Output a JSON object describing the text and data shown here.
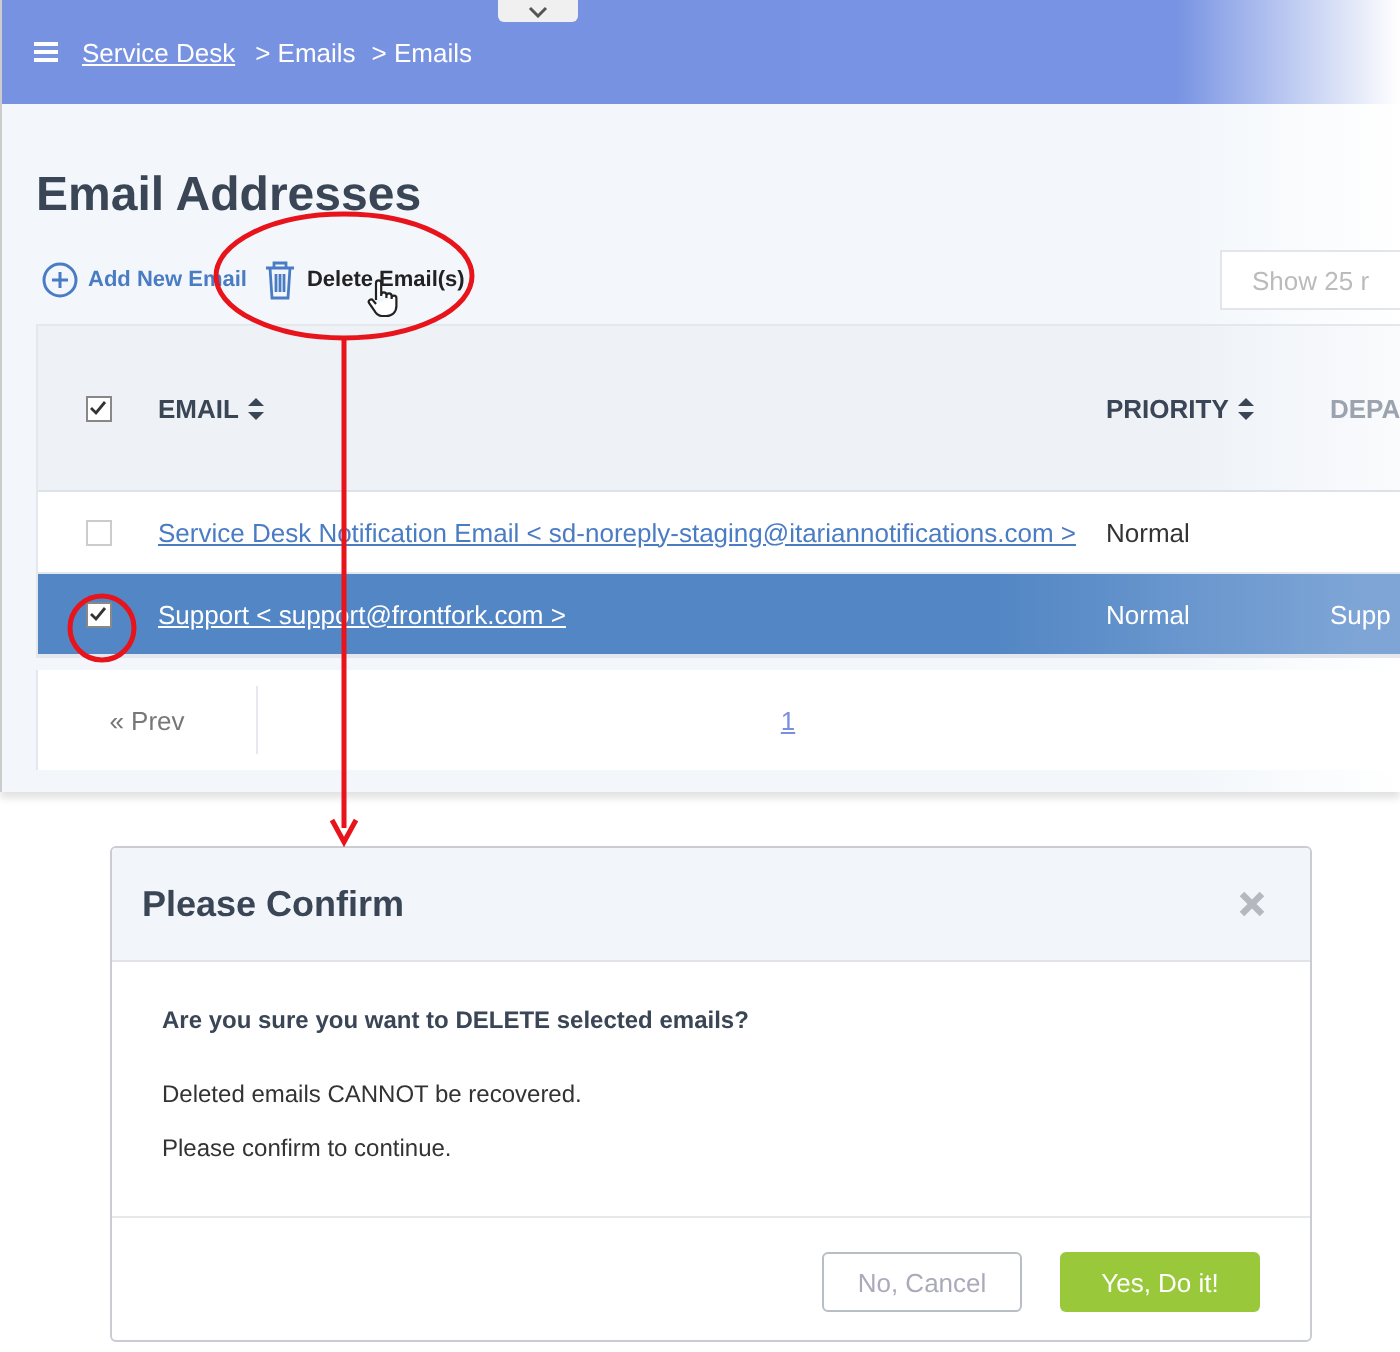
{
  "breadcrumb": {
    "home": "Service Desk",
    "trail": [
      "> Emails",
      "> Emails"
    ]
  },
  "page_title": "Email Addresses",
  "toolbar": [
    {
      "kind": "add",
      "label": "Add New Email"
    },
    {
      "kind": "delete",
      "label": "Delete Email(s)"
    }
  ],
  "page_size": "Show 25 r",
  "table": {
    "all_checked": true,
    "columns": [
      {
        "label": "EMAIL",
        "sortable": true
      },
      {
        "label": "PRIORITY",
        "sortable": true
      },
      {
        "label": "DEPA",
        "sortable": false
      }
    ],
    "rows": [
      {
        "email": "Service Desk Notification Email < sd-noreply-staging@itariannotifications.com >",
        "priority": "Normal",
        "selected": false,
        "checked": false
      },
      {
        "email": "Support < support@frontfork.com >",
        "priority": "Normal",
        "column_3": "Supp",
        "selected": true,
        "checked": true
      }
    ]
  },
  "pagination": {
    "prev": "« Prev",
    "pages": [
      "1"
    ]
  },
  "dialog": {
    "title": "Please Confirm",
    "question": "Are you sure you want to DELETE selected emails?",
    "notes": [
      "Deleted emails CANNOT be recovered.",
      "Please confirm to continue."
    ],
    "buttons": [
      {
        "kind": "cancel",
        "label": "No, Cancel"
      },
      {
        "kind": "confirm",
        "label": "Yes, Do it!"
      }
    ]
  }
}
